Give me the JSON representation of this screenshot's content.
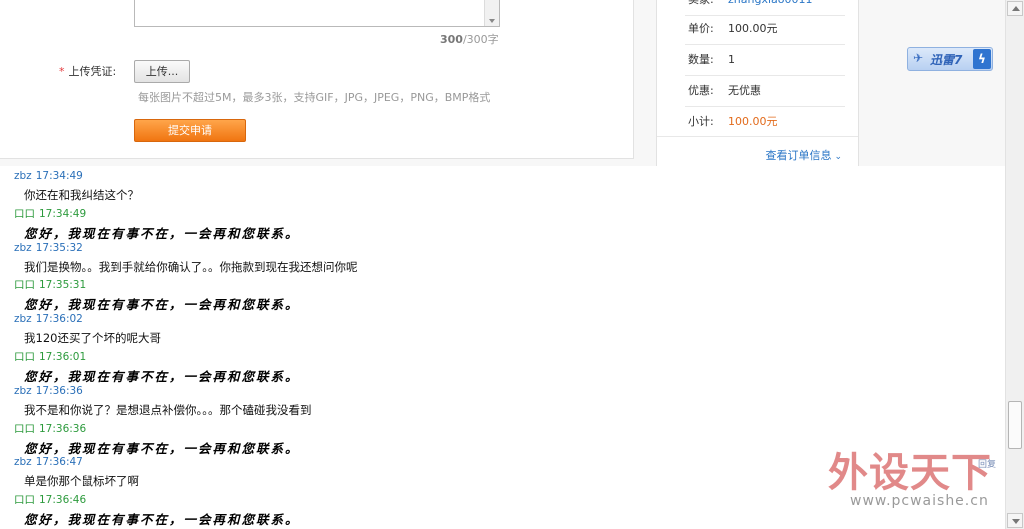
{
  "form": {
    "char_count_current": "300",
    "char_count_rest": "/300字",
    "upload_label": "上传凭证:",
    "required_mark": "*",
    "upload_button": "上传...",
    "upload_hint": "每张图片不超过5M，最多3张，支持GIF，JPG，JPEG，PNG，BMP格式",
    "submit_button": "提交申请"
  },
  "order": {
    "rows": [
      {
        "key": "单价:",
        "value": "100.00元",
        "style": "normal"
      },
      {
        "key": "数量:",
        "value": "1",
        "style": "normal"
      },
      {
        "key": "优惠:",
        "value": "无优惠",
        "style": "normal"
      },
      {
        "key": "小计:",
        "value": "100.00元",
        "style": "orange"
      }
    ],
    "view_order_link": "查看订单信息",
    "chevron": "⌄"
  },
  "xunlei": {
    "label": "迅雷7",
    "bolt": "ϟ",
    "icon": "bird-icon"
  },
  "chat": {
    "messages": [
      {
        "sender": "zbz",
        "time": "17:34:49",
        "role": "user",
        "text": "你还在和我纠结这个？"
      },
      {
        "sender": "口口",
        "time": "17:34:49",
        "role": "shop",
        "text": "您好，我现在有事不在，一会再和您联系。"
      },
      {
        "sender": "zbz",
        "time": "17:35:32",
        "role": "user",
        "text": "我们是换物。。我到手就给你确认了。。你拖款到现在我还想问你呢"
      },
      {
        "sender": "口口",
        "time": "17:35:31",
        "role": "shop",
        "text": "您好，我现在有事不在，一会再和您联系。"
      },
      {
        "sender": "zbz",
        "time": "17:36:02",
        "role": "user",
        "text": "我120还买了个坏的呢大哥"
      },
      {
        "sender": "口口",
        "time": "17:36:01",
        "role": "shop",
        "text": "您好，我现在有事不在，一会再和您联系。"
      },
      {
        "sender": "zbz",
        "time": "17:36:36",
        "role": "user",
        "text": "我不是和你说了？是想退点补偿你。。。那个磕碰我没看到"
      },
      {
        "sender": "口口",
        "time": "17:36:36",
        "role": "shop",
        "text": "您好，我现在有事不在，一会再和您联系。"
      },
      {
        "sender": "zbz",
        "time": "17:36:47",
        "role": "user",
        "text": "单是你那个鼠标坏了啊"
      },
      {
        "sender": "口口",
        "time": "17:36:46",
        "role": "shop",
        "text": "您好，我现在有事不在，一会再和您联系。"
      }
    ]
  },
  "watermark": {
    "main": "外设天下",
    "url": "www.pcwaishe.cn",
    "small": "回复"
  }
}
